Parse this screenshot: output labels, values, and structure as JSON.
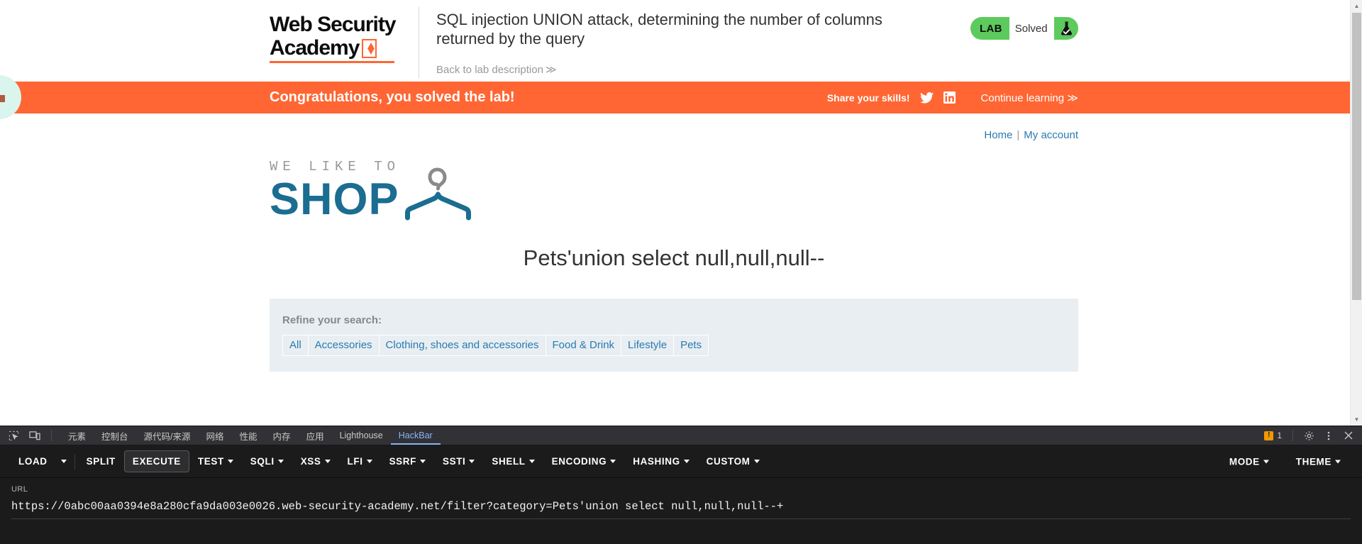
{
  "lab_header": {
    "logo_line1": "Web Security",
    "logo_line2": "Academy",
    "logo_icon": "lightning-bolt-icon",
    "title": "SQL injection UNION attack, determining the number of columns returned by the query",
    "back_link": "Back to lab description",
    "back_link_chevron": "≫",
    "badge": {
      "label": "LAB",
      "status": "Solved",
      "icon": "flask-check-icon",
      "color": "#5cca5c"
    }
  },
  "banner": {
    "message": "Congratulations, you solved the lab!",
    "share_label": "Share your skills!",
    "twitter_icon": "twitter-icon",
    "linkedin_icon": "linkedin-icon",
    "continue_link": "Continue learning ≫",
    "background": "#ff6633"
  },
  "shop": {
    "nav": {
      "home": "Home",
      "separator": "|",
      "my_account": "My account"
    },
    "logo": {
      "tagline": "WE LIKE TO",
      "word": "SHOP",
      "icon": "coat-hanger-icon",
      "color": "#1b6d91"
    },
    "search_heading": "Pets'union select null,null,null--",
    "refine": {
      "label": "Refine your search:",
      "filters": [
        "All",
        "Accessories",
        "Clothing, shoes and accessories",
        "Food & Drink",
        "Lifestyle",
        "Pets"
      ]
    }
  },
  "devtools": {
    "left_icons": [
      "inspect-element-icon",
      "device-toolbar-icon"
    ],
    "tabs": [
      {
        "label": "元素",
        "active": false
      },
      {
        "label": "控制台",
        "active": false
      },
      {
        "label": "源代码/来源",
        "active": false
      },
      {
        "label": "网络",
        "active": false
      },
      {
        "label": "性能",
        "active": false
      },
      {
        "label": "内存",
        "active": false
      },
      {
        "label": "应用",
        "active": false
      },
      {
        "label": "Lighthouse",
        "active": false
      },
      {
        "label": "HackBar",
        "active": true
      }
    ],
    "warning_count": "1",
    "right_icons": [
      "gear-icon",
      "kebab-menu-icon",
      "close-icon"
    ]
  },
  "hackbar": {
    "buttons": [
      {
        "label": "LOAD",
        "caret": false,
        "boxed": false
      },
      {
        "label": "SPLIT",
        "caret": false,
        "boxed": false
      },
      {
        "label": "EXECUTE",
        "caret": false,
        "boxed": true
      },
      {
        "label": "TEST",
        "caret": true,
        "boxed": false
      },
      {
        "label": "SQLI",
        "caret": true,
        "boxed": false
      },
      {
        "label": "XSS",
        "caret": true,
        "boxed": false
      },
      {
        "label": "LFI",
        "caret": true,
        "boxed": false
      },
      {
        "label": "SSRF",
        "caret": true,
        "boxed": false
      },
      {
        "label": "SSTI",
        "caret": true,
        "boxed": false
      },
      {
        "label": "SHELL",
        "caret": true,
        "boxed": false
      },
      {
        "label": "ENCODING",
        "caret": true,
        "boxed": false
      },
      {
        "label": "HASHING",
        "caret": true,
        "boxed": false
      },
      {
        "label": "CUSTOM",
        "caret": true,
        "boxed": false
      }
    ],
    "right_buttons": [
      {
        "label": "MODE",
        "caret": true
      },
      {
        "label": "THEME",
        "caret": true
      }
    ],
    "url_label": "URL",
    "url_value": "https://0abc00aa0394e8a280cfa9da003e0026.web-security-academy.net/filter?category=Pets'union select null,null,null--+"
  }
}
